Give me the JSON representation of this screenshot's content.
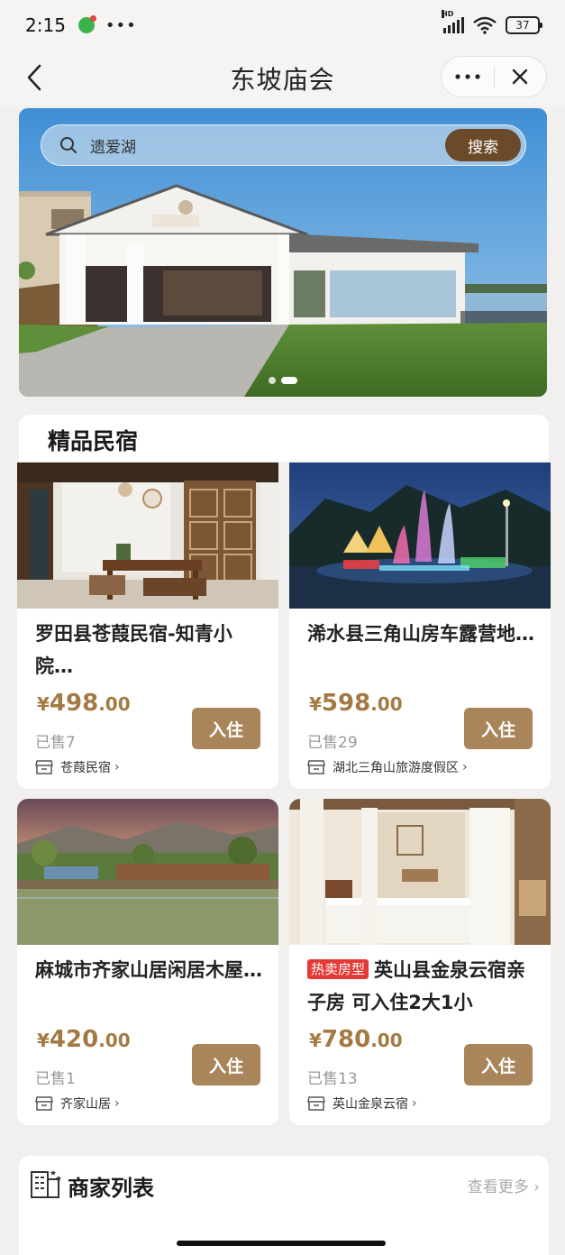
{
  "status_bar": {
    "time": "2:15",
    "battery": "37"
  },
  "nav": {
    "title": "东坡庙会"
  },
  "search": {
    "query": "遗爱湖",
    "button": "搜索"
  },
  "banner": {
    "slide_count": 2,
    "active_slide": 2
  },
  "section": {
    "title": "精品民宿"
  },
  "listings": [
    {
      "name": "罗田县苍葭民宿-知青小院…",
      "tag": "",
      "price_currency": "¥",
      "price_int": "498",
      "price_dec": ".00",
      "sold": "已售7",
      "shop": "苍葭民宿",
      "button": "入住"
    },
    {
      "name": "浠水县三角山房车露营地…",
      "tag": "",
      "price_currency": "¥",
      "price_int": "598",
      "price_dec": ".00",
      "sold": "已售29",
      "shop": "湖北三角山旅游度假区",
      "button": "入住"
    },
    {
      "name": "麻城市齐家山居闲居木屋…",
      "tag": "",
      "price_currency": "¥",
      "price_int": "420",
      "price_dec": ".00",
      "sold": "已售1",
      "shop": "齐家山居",
      "button": "入住"
    },
    {
      "name": "英山县金泉云宿亲子房 可入住2大1小",
      "tag": "热卖房型",
      "price_currency": "¥",
      "price_int": "780",
      "price_dec": ".00",
      "sold": "已售13",
      "shop": "英山金泉云宿",
      "button": "入住"
    }
  ],
  "merchant_section": {
    "title": "商家列表",
    "more": "查看更多"
  },
  "colors": {
    "accent_brown": "#a98559",
    "search_button": "#6b4a2a",
    "price": "#a47a44",
    "hot_tag": "#e53935"
  },
  "icons": [
    "back-arrow-icon",
    "more-dots-icon",
    "close-icon",
    "search-icon",
    "shop-icon",
    "chevron-right-icon",
    "building-icon"
  ]
}
